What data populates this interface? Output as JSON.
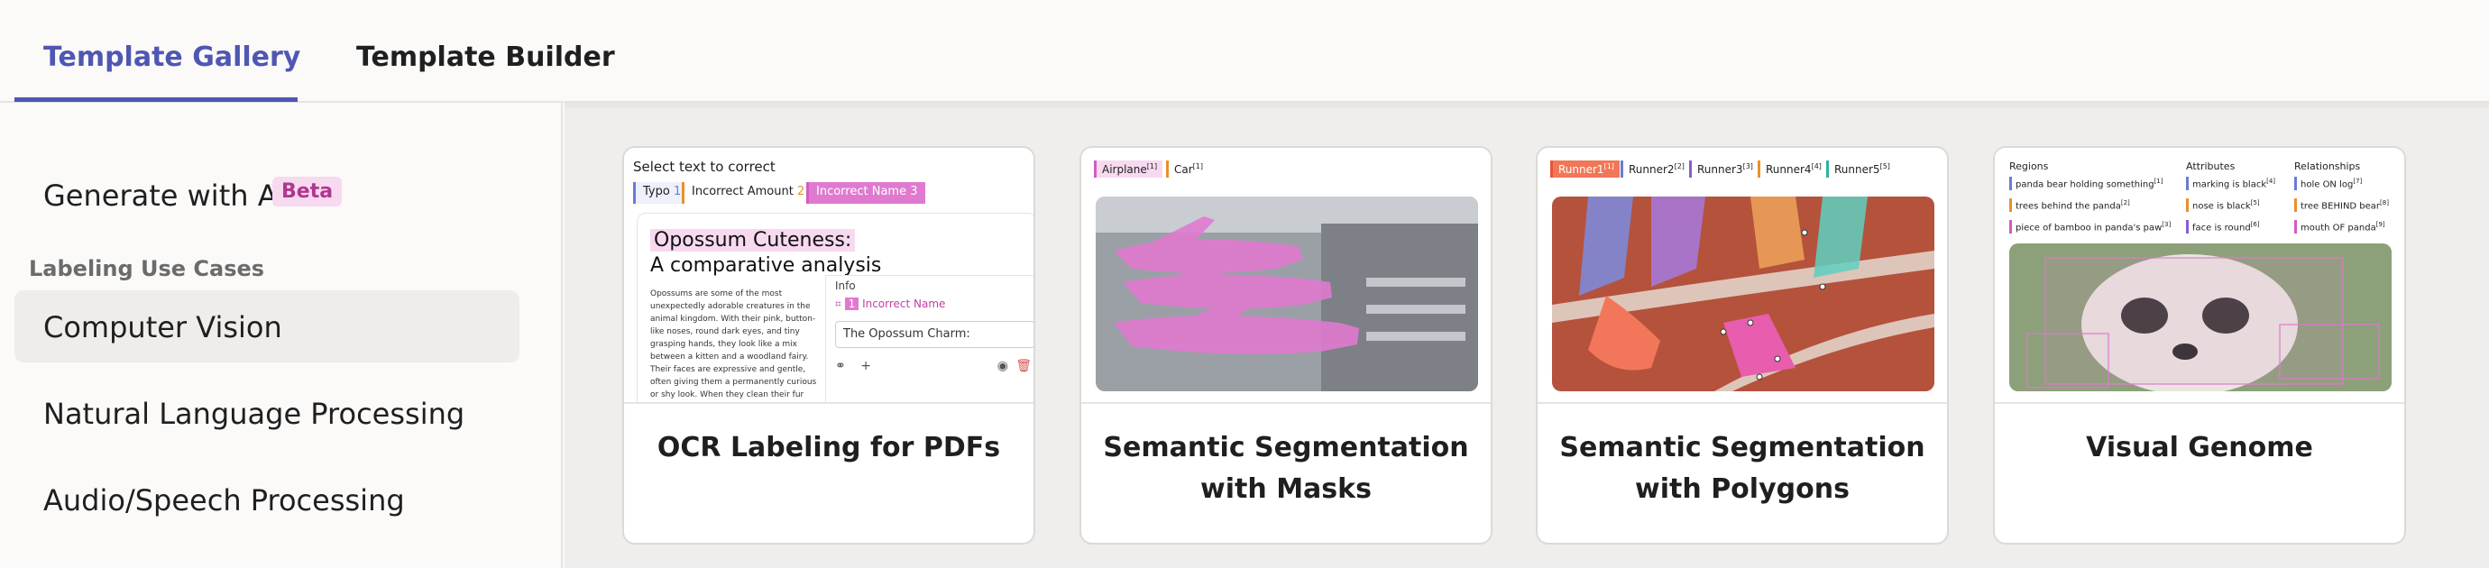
{
  "tabs": [
    {
      "label": "Template Gallery",
      "active": true
    },
    {
      "label": "Template Builder",
      "active": false
    }
  ],
  "sidebar": {
    "generate": {
      "label": "Generate with AI",
      "badge": "Beta"
    },
    "section_heading": "Labeling Use Cases",
    "items": [
      {
        "label": "Computer Vision",
        "active": true
      },
      {
        "label": "Natural Language Processing",
        "active": false
      },
      {
        "label": "Audio/Speech Processing",
        "active": false
      }
    ]
  },
  "cards": [
    {
      "title": "OCR Labeling for PDFs",
      "preview": {
        "heading": "Select text to correct",
        "chips": [
          "Typo",
          "Incorrect Amount",
          "Incorrect Name"
        ],
        "chip_counts": [
          "1",
          "2",
          "3"
        ],
        "doc_title_1": "Opossum Cuteness:",
        "doc_title_2": "A comparative analysis",
        "doc_body": "Opossums are some of the most unexpectedly adorable creatures in the animal kingdom. With their pink, button-like noses, round dark eyes, and tiny grasping hands, they look like a mix between a kitten and a woodland fairy. Their faces are expressive and gentle, often giving them a permanently curious or shy look. When they clean their fur with their hands or peek out from behind",
        "panel_info": "Info",
        "panel_label": "Incorrect Name",
        "panel_count": "1",
        "panel_value": "The Opossum Charm:"
      }
    },
    {
      "title": "Semantic Segmentation with Masks",
      "preview": {
        "labels": [
          "Airplane",
          "Car"
        ],
        "label_sup": [
          "[1]",
          "[1]"
        ]
      }
    },
    {
      "title": "Semantic Segmentation with Polygons",
      "preview": {
        "labels": [
          "Runner1",
          "Runner2",
          "Runner3",
          "Runner4",
          "Runner5"
        ],
        "label_sup": [
          "[1]",
          "[2]",
          "[3]",
          "[4]",
          "[5]"
        ]
      }
    },
    {
      "title": "Visual Genome",
      "preview": {
        "regions_heading": "Regions",
        "attributes_heading": "Attributes",
        "relationships_heading": "Relationships",
        "regions": [
          "panda bear holding something",
          "trees behind the panda",
          "piece of bamboo in panda's paw"
        ],
        "regions_sup": [
          "[1]",
          "[2]",
          "[3]"
        ],
        "attributes": [
          "marking is black",
          "nose is black",
          "face is round"
        ],
        "attributes_sup": [
          "[4]",
          "[5]",
          "[6]"
        ],
        "relationships": [
          "hole ON log",
          "tree BEHIND bear",
          "mouth OF panda"
        ],
        "relationships_sup": [
          "[7]",
          "[8]",
          "[9]"
        ]
      }
    }
  ],
  "colors": {
    "accent": "#4f57b3",
    "badge_bg": "#f7d9f0",
    "badge_text": "#b0378f",
    "mask_pink": "#e07ad0"
  }
}
